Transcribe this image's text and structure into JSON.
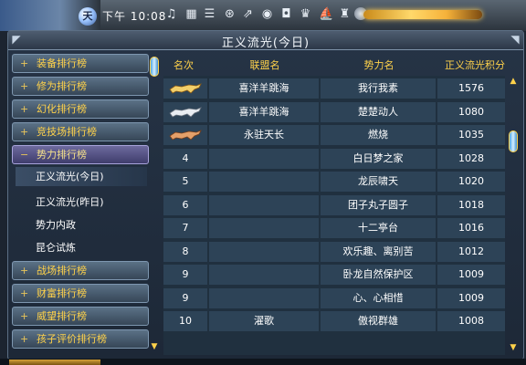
{
  "topbar": {
    "gem_label": "天",
    "clock": "下午 10:08",
    "icons": [
      "music-icon",
      "grid-icon",
      "mail-icon",
      "settings-icon",
      "share-icon",
      "globe-icon",
      "camera-icon",
      "trophy-icon",
      "boat-icon",
      "hat-icon"
    ]
  },
  "window": {
    "title": "正义流光(今日)"
  },
  "sidebar": {
    "items": [
      {
        "label": "装备排行榜",
        "type": "category"
      },
      {
        "label": "修为排行榜",
        "type": "category"
      },
      {
        "label": "幻化排行榜",
        "type": "category"
      },
      {
        "label": "竞技场排行榜",
        "type": "category"
      },
      {
        "label": "势力排行榜",
        "type": "category-open"
      },
      {
        "label": "正义流光(今日)",
        "type": "sub-selected"
      },
      {
        "label": "正义流光(昨日)",
        "type": "sub"
      },
      {
        "label": "势力内政",
        "type": "sub"
      },
      {
        "label": "昆仑试炼",
        "type": "sub"
      },
      {
        "label": "战场排行榜",
        "type": "category"
      },
      {
        "label": "财富排行榜",
        "type": "category"
      },
      {
        "label": "威望排行榜",
        "type": "category"
      },
      {
        "label": "孩子评价排行榜",
        "type": "category"
      }
    ]
  },
  "table": {
    "headers": {
      "rank": "名次",
      "alliance": "联盟名",
      "faction": "势力名",
      "score": "正义流光积分"
    },
    "rows": [
      {
        "rank": "",
        "rank_icon": "gold-wolf-icon",
        "alliance": "喜洋羊跳海",
        "faction": "我行我素",
        "score": "1576"
      },
      {
        "rank": "",
        "rank_icon": "silver-wolf-icon",
        "alliance": "喜洋羊跳海",
        "faction": "楚楚动人",
        "score": "1080"
      },
      {
        "rank": "",
        "rank_icon": "bronze-wolf-icon",
        "alliance": "永驻天长",
        "faction": "燃烧",
        "score": "1035"
      },
      {
        "rank": "4",
        "alliance": "",
        "faction": "白日梦之家",
        "score": "1028"
      },
      {
        "rank": "5",
        "alliance": "",
        "faction": "龙辰啸天",
        "score": "1020"
      },
      {
        "rank": "6",
        "alliance": "",
        "faction": "团子丸子圆子",
        "score": "1018"
      },
      {
        "rank": "7",
        "alliance": "",
        "faction": "十二亭台",
        "score": "1016"
      },
      {
        "rank": "8",
        "alliance": "",
        "faction": "欢乐趣、离别苦",
        "score": "1012"
      },
      {
        "rank": "9",
        "alliance": "",
        "faction": "卧龙自然保护区",
        "score": "1009"
      },
      {
        "rank": "9",
        "alliance": "",
        "faction": "心、心相惜",
        "score": "1009"
      },
      {
        "rank": "10",
        "alliance": "濯歌",
        "faction": "傲视群雄",
        "score": "1008"
      }
    ]
  },
  "colors": {
    "header_gold": "#ffd24a",
    "row_band": "#2d4357",
    "window_bg": "#1d2837"
  }
}
